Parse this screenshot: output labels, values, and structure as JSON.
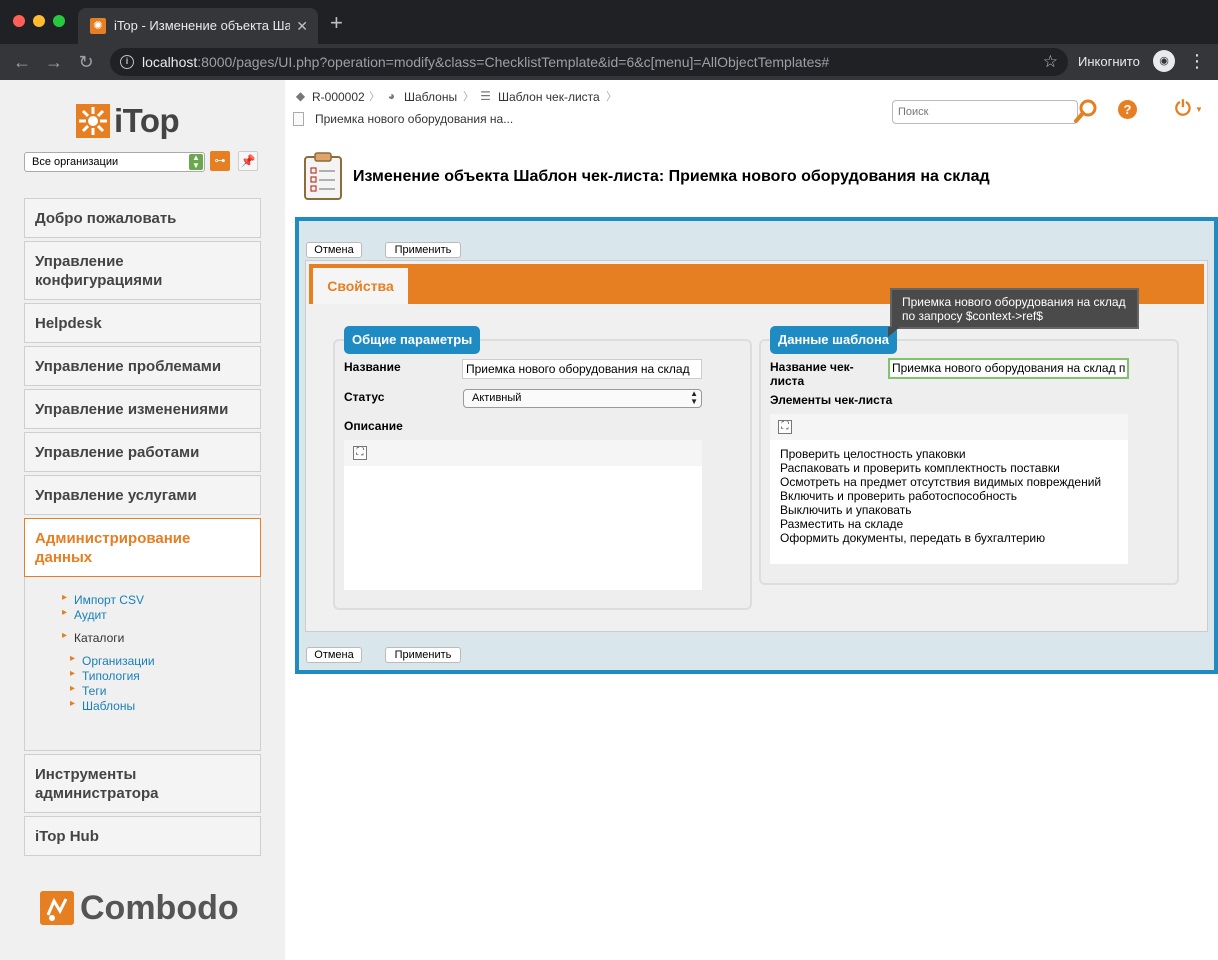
{
  "browser": {
    "tab_title": "iTop - Изменение объекта Шаблон чек-листа",
    "tab_favicon": "iTop-favicon",
    "url_host": "localhost",
    "url_rest": ":8000/pages/UI.php?operation=modify&class=ChecklistTemplate&id=6&c[menu]=AllObjectTemplates#",
    "incognito_label": "Инкогнито"
  },
  "sidebar": {
    "logo_text": "iTop",
    "org_select_value": "Все организации",
    "menu": [
      {
        "label": "Добро пожаловать"
      },
      {
        "label": "Управление конфигурациями"
      },
      {
        "label": "Helpdesk"
      },
      {
        "label": "Управление проблемами"
      },
      {
        "label": "Управление изменениями"
      },
      {
        "label": "Управление работами"
      },
      {
        "label": "Управление услугами"
      },
      {
        "label": "Администрирование данных"
      },
      {
        "label": "Инструменты администратора"
      },
      {
        "label": "iTop Hub"
      }
    ],
    "submenu": {
      "import_csv": "Импорт CSV",
      "audit": "Аудит",
      "catalogs": "Каталоги",
      "organizations": "Организации",
      "typology": "Типология",
      "tags": "Теги",
      "templates": "Шаблоны"
    },
    "footer_logo_text": "Combodo"
  },
  "header": {
    "breadcrumb": {
      "item1": "R-000002",
      "item2": "Шаблоны",
      "item3": "Шаблон чек-листа",
      "current": "Приемка нового оборудования на..."
    },
    "search_placeholder": "Поиск",
    "page_title": "Изменение объекта Шаблон чек-листа: Приемка нового оборудования на склад"
  },
  "form": {
    "cancel_label": "Отмена",
    "apply_label": "Применить",
    "tab_label": "Свойства",
    "general": {
      "legend": "Общие параметры",
      "name_label": "Название",
      "name_value": "Приемка нового оборудования на склад",
      "status_label": "Статус",
      "status_value": "Активный",
      "description_label": "Описание"
    },
    "template": {
      "legend": "Данные шаблона",
      "checklist_name_label": "Название чек-листа",
      "checklist_name_value": "Приемка нового оборудования на склад п",
      "items_label": "Элементы чек-листа",
      "items": [
        "Проверить целостность упаковки",
        "Распаковать и проверить комплектность поставки",
        "Осмотреть на предмет отсутствия видимых повреждений",
        "Включить и проверить работоспособность",
        "Выключить и упаковать",
        "Разместить на складе",
        "Оформить документы, передать в бухгалтерию"
      ]
    },
    "tooltip": {
      "line1": "Приемка нового оборудования на склад",
      "line2": "по запросу $context->ref$"
    }
  },
  "colors": {
    "accent_orange": "#e67e22",
    "accent_blue": "#1f8bc3"
  }
}
